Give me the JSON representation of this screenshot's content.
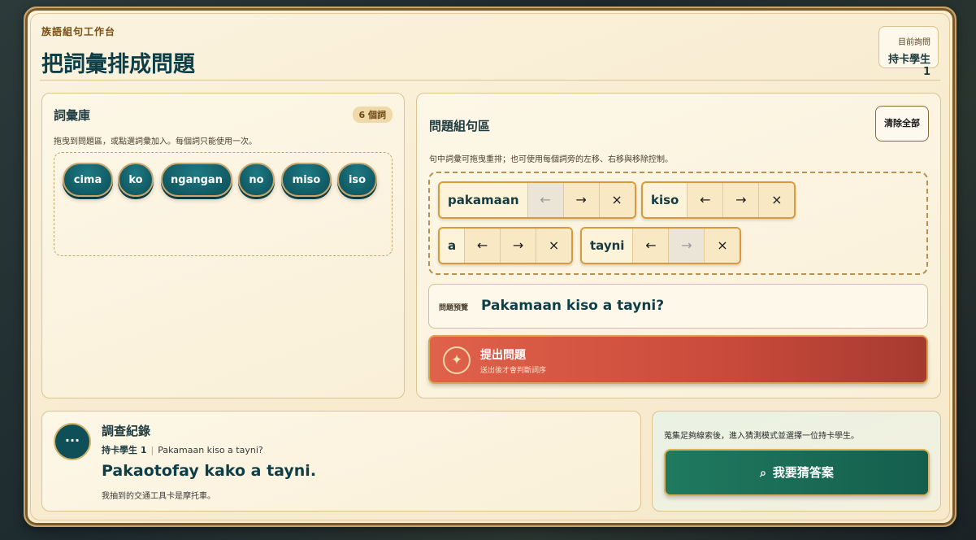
{
  "header": {
    "kicker": "族語組句工作台",
    "title": "把詞彙排成問題"
  },
  "asker": {
    "label": "目前詢問",
    "value": "持卡學生 1"
  },
  "bank": {
    "title": "詞彙庫",
    "count_badge": "6 個詞",
    "hint": "拖曳到問題區，或點選詞彙加入。每個詞只能使用一次。",
    "chips": [
      "cima",
      "ko",
      "ngangan",
      "no",
      "miso",
      "iso"
    ]
  },
  "composer": {
    "title": "問題組句區",
    "clear_label": "清除全部",
    "hint": "句中詞彙可拖曳重排；也可使用每個詞旁的左移、右移與移除控制。",
    "tokens": [
      "pakamaan",
      "kiso",
      "a",
      "tayni"
    ],
    "controls": {
      "left": "←",
      "right": "→",
      "remove": "×"
    },
    "preview_label": "問題預覽",
    "preview_text": "Pakamaan kiso a tayni?",
    "submit_label": "提出問題",
    "submit_sub": "送出後才會判斷詞序",
    "submit_icon": "sparkle-icon"
  },
  "log": {
    "title": "調查紀錄",
    "avatar_text": "···",
    "asker": "持卡學生 1",
    "question": "Pakamaan kiso a tayni?",
    "answer": "Pakaotofay kako a tayni.",
    "note": "我抽到的交通工具卡是摩托車。"
  },
  "guess": {
    "hint": "蒐集足夠線索後，進入猜測模式並選擇一位持卡學生。",
    "button_label": "我要猜答案",
    "button_icon": "search-icon"
  }
}
